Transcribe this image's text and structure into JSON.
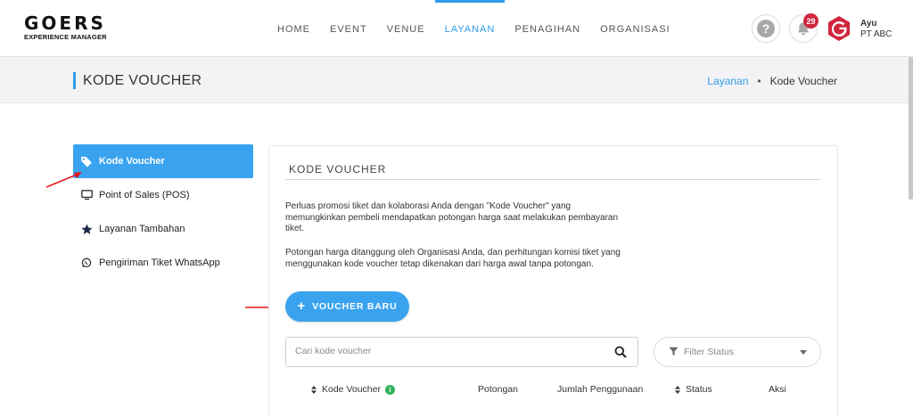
{
  "brand": {
    "logo_main": "GOERS",
    "logo_sub": "EXPERIENCE MANAGER"
  },
  "nav": {
    "items": [
      {
        "label": "HOME"
      },
      {
        "label": "EVENT"
      },
      {
        "label": "VENUE"
      },
      {
        "label": "LAYANAN",
        "active": true
      },
      {
        "label": "PENAGIHAN"
      },
      {
        "label": "ORGANISASI"
      }
    ]
  },
  "header": {
    "help_glyph": "?",
    "notification_count": "29",
    "user_name": "Ayu",
    "user_org": "PT ABC",
    "avatar_letter": "G",
    "avatar_color": "#d0263c"
  },
  "page": {
    "title": "KODE VOUCHER",
    "breadcrumb": {
      "parent": "Layanan",
      "separator": "•",
      "current": "Kode Voucher"
    }
  },
  "sidebar": {
    "items": [
      {
        "label": "Kode Voucher",
        "icon": "tag-icon",
        "active": true
      },
      {
        "label": "Point of Sales (POS)",
        "icon": "monitor-icon"
      },
      {
        "label": "Layanan Tambahan",
        "icon": "star-icon"
      },
      {
        "label": "Pengiriman Tiket WhatsApp",
        "icon": "whatsapp-icon"
      }
    ]
  },
  "main": {
    "section_title": "KODE VOUCHER",
    "paragraph_1": "Perluas promosi tiket dan kolaborasi Anda dengan \"Kode Voucher\" yang memungkinkan pembeli mendapatkan potongan harga saat melakukan pembayaran tiket.",
    "paragraph_2": "Potongan harga ditanggung oleh Organisasi Anda, dan perhitungan komisi tiket yang menggunakan kode voucher tetap dikenakan dari harga awal tanpa potongan.",
    "new_voucher_label": "VOUCHER BARU",
    "search_placeholder": "Cari kode voucher",
    "filter_placeholder": "Filter Status",
    "table": {
      "columns": [
        "Kode Voucher",
        "Potongan",
        "Jumlah Penggunaan",
        "Status",
        "Aksi"
      ]
    }
  },
  "colors": {
    "accent": "#2f9be8",
    "button": "#3aa3ef",
    "badge": "#d0263c",
    "annotation_arrow": "#e0181b"
  }
}
